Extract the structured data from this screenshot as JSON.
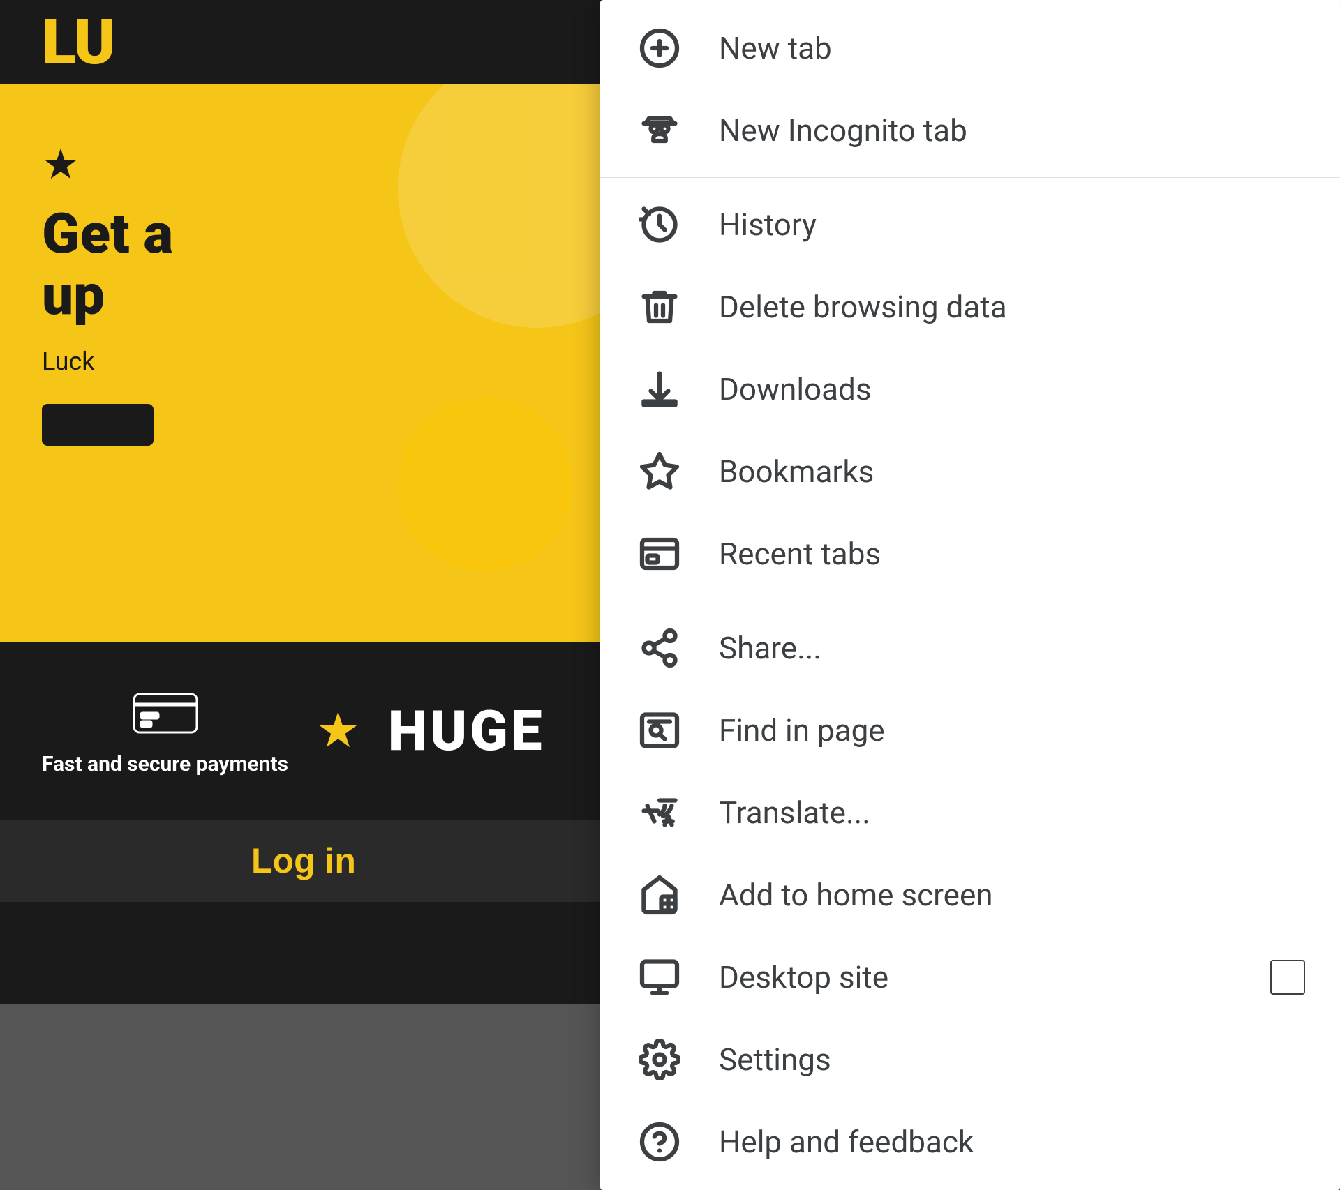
{
  "website": {
    "logo": "LU",
    "star": "★",
    "promo_title": "Get a",
    "promo_title2": "up",
    "promo_sub": "Luck",
    "payment_label": "Fast and secure payments",
    "star_gold": "★",
    "huge_label": "HUGE",
    "login_label": "Log in"
  },
  "menu": {
    "items": [
      {
        "id": "new-tab",
        "label": "New tab",
        "icon": "plus-circle",
        "divider_after": false
      },
      {
        "id": "new-incognito-tab",
        "label": "New Incognito tab",
        "icon": "incognito",
        "divider_after": true
      },
      {
        "id": "history",
        "label": "History",
        "icon": "history",
        "divider_after": false
      },
      {
        "id": "delete-browsing-data",
        "label": "Delete browsing data",
        "icon": "trash",
        "divider_after": false
      },
      {
        "id": "downloads",
        "label": "Downloads",
        "icon": "download",
        "divider_after": false
      },
      {
        "id": "bookmarks",
        "label": "Bookmarks",
        "icon": "star",
        "divider_after": false
      },
      {
        "id": "recent-tabs",
        "label": "Recent tabs",
        "icon": "recent-tabs",
        "divider_after": true
      },
      {
        "id": "share",
        "label": "Share...",
        "icon": "share",
        "divider_after": false
      },
      {
        "id": "find-in-page",
        "label": "Find in page",
        "icon": "find",
        "divider_after": false
      },
      {
        "id": "translate",
        "label": "Translate...",
        "icon": "translate",
        "divider_after": false
      },
      {
        "id": "add-to-home-screen",
        "label": "Add to home screen",
        "icon": "add-home",
        "divider_after": false
      },
      {
        "id": "desktop-site",
        "label": "Desktop site",
        "icon": "desktop",
        "has_checkbox": true,
        "divider_after": false
      },
      {
        "id": "settings",
        "label": "Settings",
        "icon": "settings",
        "divider_after": false
      },
      {
        "id": "help-and-feedback",
        "label": "Help and feedback",
        "icon": "help",
        "divider_after": false
      }
    ]
  }
}
